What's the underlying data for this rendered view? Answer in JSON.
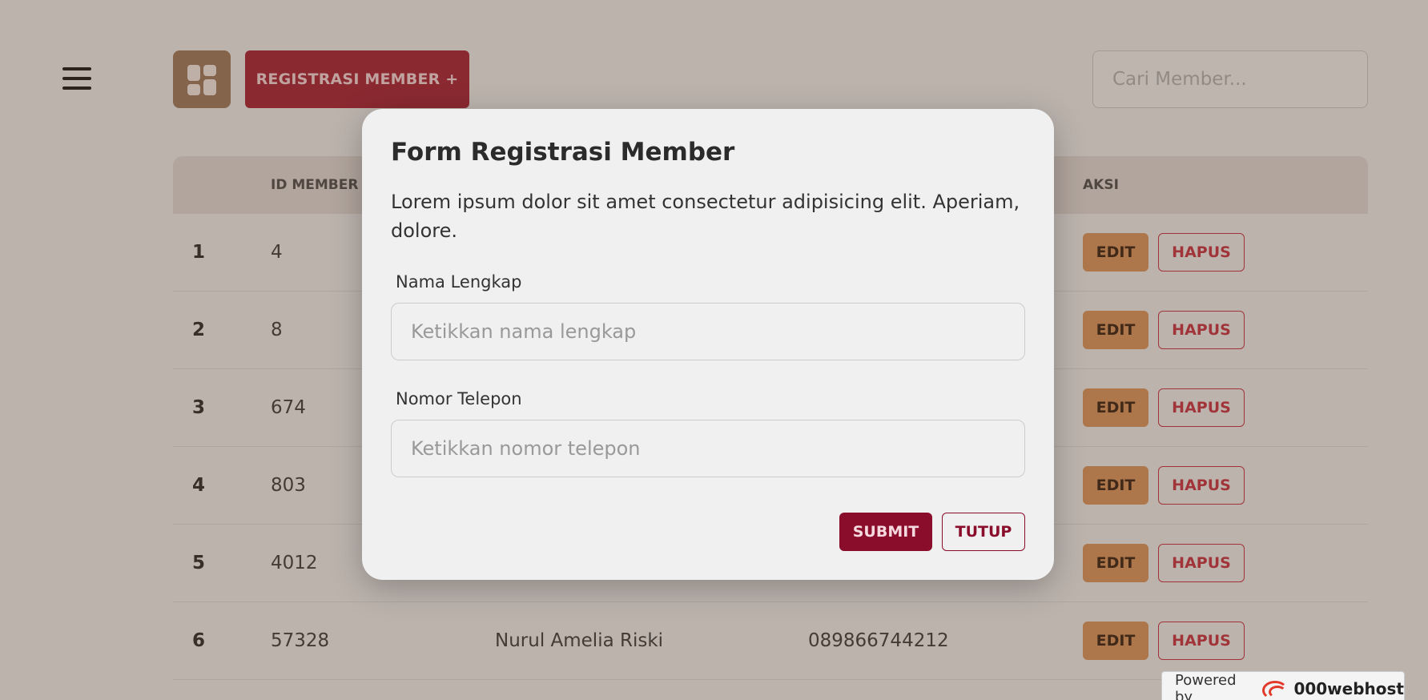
{
  "header": {
    "register_label": "REGISTRASI MEMBER +",
    "search_placeholder": "Cari Member..."
  },
  "table": {
    "col_id": "ID MEMBER",
    "col_action": "AKSI",
    "edit_label": "EDIT",
    "delete_label": "HAPUS",
    "rows": [
      {
        "no": "1",
        "id": "4"
      },
      {
        "no": "2",
        "id": "8"
      },
      {
        "no": "3",
        "id": "674"
      },
      {
        "no": "4",
        "id": "803"
      },
      {
        "no": "5",
        "id": "4012"
      },
      {
        "no": "6",
        "id": "57328",
        "name": "Nurul Amelia Riski",
        "phone": "089866744212"
      }
    ]
  },
  "modal": {
    "title": "Form Registrasi Member",
    "description": "Lorem ipsum dolor sit amet consectetur adipisicing elit. Aperiam, dolore.",
    "name_label": "Nama Lengkap",
    "name_placeholder": "Ketikkan nama lengkap",
    "phone_label": "Nomor Telepon",
    "phone_placeholder": "Ketikkan nomor telepon",
    "submit_label": "SUBMIT",
    "close_label": "TUTUP"
  },
  "watermark": {
    "powered_by": "Powered by",
    "brand": "000webhost"
  },
  "colors": {
    "primary": "#8b0d2c",
    "accent_edit": "#dc9a64",
    "dashboard_button": "#a07e64"
  }
}
